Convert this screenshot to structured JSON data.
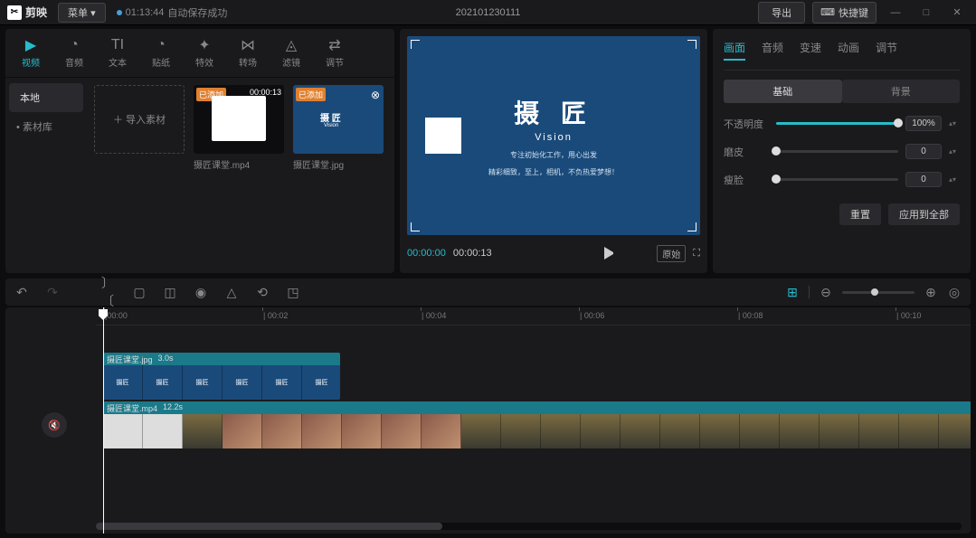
{
  "titlebar": {
    "app_name": "剪映",
    "menu_label": "菜单",
    "save_time": "01:13:44",
    "save_status": "自动保存成功",
    "project_name": "202101230111",
    "export_label": "导出",
    "shortcut_label": "快捷键"
  },
  "tool_tabs": [
    {
      "label": "视频",
      "icon": "▶"
    },
    {
      "label": "音频",
      "icon": "◔"
    },
    {
      "label": "文本",
      "icon": "TI"
    },
    {
      "label": "贴纸",
      "icon": "◔"
    },
    {
      "label": "特效",
      "icon": "✦"
    },
    {
      "label": "转场",
      "icon": "⋈"
    },
    {
      "label": "滤镜",
      "icon": "◬"
    },
    {
      "label": "调节",
      "icon": "⇄"
    }
  ],
  "media_side": [
    {
      "label": "本地",
      "active": true
    },
    {
      "label": "素材库",
      "active": false
    }
  ],
  "import_label": "＋ 导入素材",
  "media_items": [
    {
      "name": "摄匠课堂.mp4",
      "duration": "00:00:13",
      "badge": "已添加",
      "blue": false
    },
    {
      "name": "摄匠课堂.jpg",
      "duration": "",
      "badge": "已添加",
      "blue": true
    }
  ],
  "preview": {
    "title": "摄 匠",
    "subtitle": "Vision",
    "line1": "专注初始化工作，用心出发",
    "line2": "精彩细致，至上，相机，不负热爱梦想！",
    "current_time": "00:00:00",
    "total_time": "00:00:13",
    "original_label": "原始"
  },
  "prop_tabs": [
    "画面",
    "音频",
    "变速",
    "动画",
    "调节"
  ],
  "sub_tabs": [
    "基础",
    "背景"
  ],
  "props": {
    "opacity_label": "不透明度",
    "opacity_value": "100%",
    "skin_label": "磨皮",
    "skin_value": "0",
    "face_label": "瘦脸",
    "face_value": "0",
    "reset_label": "重置",
    "apply_all_label": "应用到全部"
  },
  "ruler_ticks": [
    "|00:00",
    "| 00:02",
    "| 00:04",
    "| 00:06",
    "| 00:08",
    "| 00:10"
  ],
  "clips": [
    {
      "name": "摄匠课堂.jpg",
      "duration": "3.0s"
    },
    {
      "name": "摄匠课堂.mp4",
      "duration": "12.2s"
    }
  ]
}
